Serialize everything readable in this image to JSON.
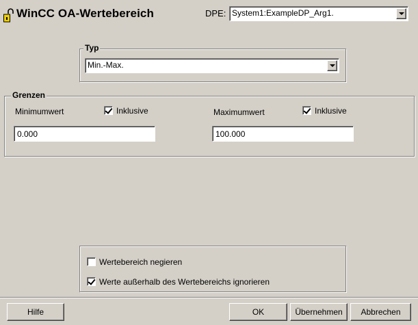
{
  "window": {
    "title": "WinCC OA-Wertebereich",
    "icon": "lock-icon"
  },
  "dpe": {
    "label": "DPE:",
    "value": "System1:ExampleDP_Arg1."
  },
  "typ": {
    "legend": "Typ",
    "selected": "Min.-Max."
  },
  "grenzen": {
    "legend": "Grenzen",
    "min_label": "Minimumwert",
    "min_inclusive_label": "Inklusive",
    "min_inclusive_checked": true,
    "min_value": "0.000",
    "max_label": "Maximumwert",
    "max_inclusive_label": "Inklusive",
    "max_inclusive_checked": true,
    "max_value": "100.000"
  },
  "options": {
    "negate_label": "Wertebereich negieren",
    "negate_checked": false,
    "ignore_label": "Werte außerhalb des Wertebereichs ignorieren",
    "ignore_checked": true
  },
  "buttons": {
    "help": "Hilfe",
    "ok": "OK",
    "apply": "Übernehmen",
    "cancel": "Abbrechen"
  }
}
